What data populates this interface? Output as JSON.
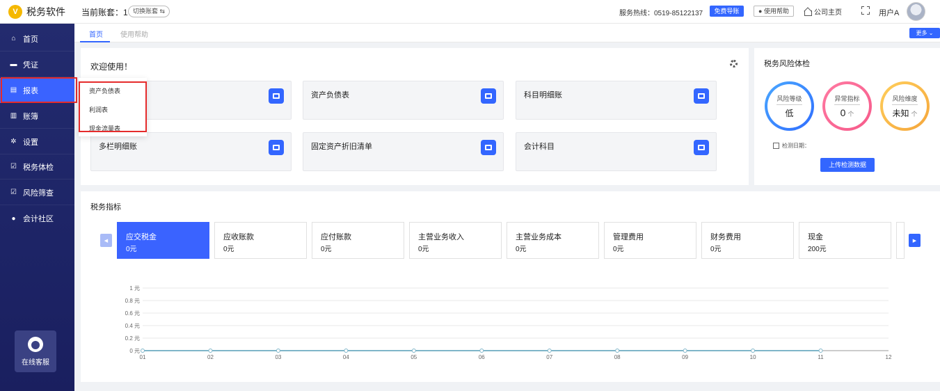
{
  "app": {
    "name": "税务软件",
    "logo_letter": "V"
  },
  "topbar": {
    "account_label": "当前账套：",
    "account_value": "1",
    "switch_label": "切换账套",
    "hotline": "服务热线：0519-85122137",
    "free_label": "免费导账",
    "help_label": "使用帮助",
    "home_label": "公司主页",
    "user_name": "用户A"
  },
  "sidebar": {
    "items": [
      {
        "label": "首页",
        "icon": "home-icon"
      },
      {
        "label": "凭证",
        "icon": "voucher-icon"
      },
      {
        "label": "报表",
        "icon": "report-icon"
      },
      {
        "label": "账簿",
        "icon": "ledger-icon"
      },
      {
        "label": "设置",
        "icon": "gear-icon"
      },
      {
        "label": "税务体检",
        "icon": "checkup-icon"
      },
      {
        "label": "风险筛查",
        "icon": "risk-icon"
      },
      {
        "label": "会计社区",
        "icon": "pin-icon"
      }
    ],
    "service_label": "在线客服"
  },
  "submenu": {
    "items": [
      "资产负债表",
      "利润表",
      "现金流量表"
    ]
  },
  "tabs": {
    "items": [
      "首页",
      "使用帮助"
    ],
    "more_label": "更多"
  },
  "welcome": {
    "title": "欢迎使用！",
    "tiles": [
      "",
      "资产负债表",
      "科目明细账",
      "多栏明细账",
      "固定资产折旧清单",
      "会计科目"
    ]
  },
  "risk": {
    "title": "税务风险体检",
    "rings": [
      {
        "label": "风险等级",
        "value": "低",
        "color_a": "#4aa8ff",
        "color_b": "#2f6dff"
      },
      {
        "label": "异常指标",
        "value": "0",
        "arrow": "个",
        "color_a": "#ff7aa2",
        "color_b": "#f65a8a"
      },
      {
        "label": "风险维度",
        "value": "未知",
        "arrow": "个",
        "color_a": "#ffcf5c",
        "color_b": "#f5a53a"
      }
    ],
    "check_date_label": "检测日期：",
    "upload_label": "上传检测数据"
  },
  "indicators": {
    "title": "税务指标",
    "kpis": [
      {
        "name": "应交税金",
        "value": "0元"
      },
      {
        "name": "应收账款",
        "value": "0元"
      },
      {
        "name": "应付账款",
        "value": "0元"
      },
      {
        "name": "主营业务收入",
        "value": "0元"
      },
      {
        "name": "主营业务成本",
        "value": "0元"
      },
      {
        "name": "管理费用",
        "value": "0元"
      },
      {
        "name": "财务费用",
        "value": "0元"
      },
      {
        "name": "现金",
        "value": "200元"
      }
    ]
  },
  "chart_data": {
    "type": "line",
    "x": [
      "01",
      "02",
      "03",
      "04",
      "05",
      "06",
      "07",
      "08",
      "09",
      "10",
      "11",
      "12"
    ],
    "y_ticks": [
      "1 元",
      "0.8 元",
      "0.6 元",
      "0.4 元",
      "0.2 元",
      "0 元"
    ],
    "ylim": [
      0,
      1
    ],
    "series": [
      {
        "values": [
          0,
          0,
          0,
          0,
          0,
          0,
          0,
          0,
          0,
          0,
          0
        ],
        "color": "#7fb5c9"
      }
    ],
    "grid": true
  }
}
